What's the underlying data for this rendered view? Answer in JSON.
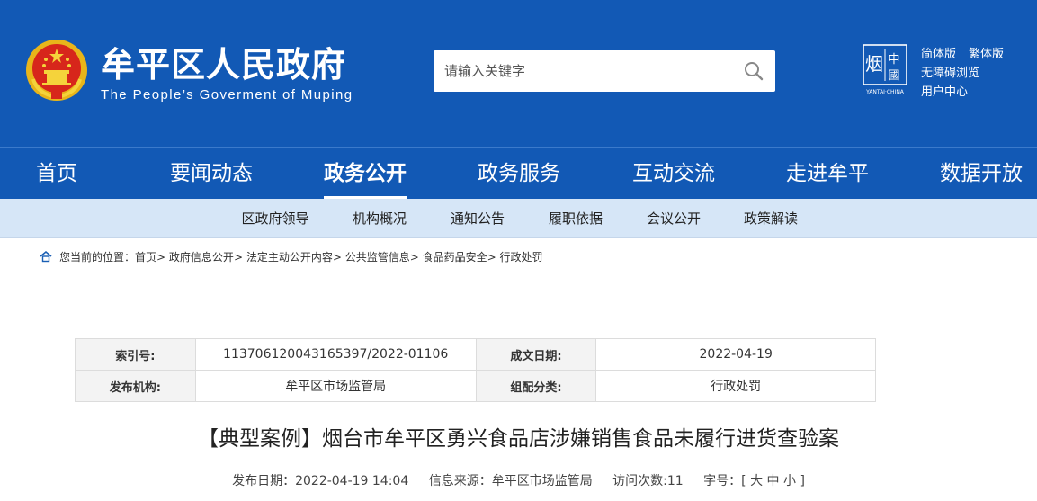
{
  "header": {
    "title": "牟平区人民政府",
    "subtitle": "The People’s Goverment of Muping",
    "search": {
      "placeholder": "请输入关键字"
    },
    "yantai_logo_text": "YANTAI·CHINA",
    "links": {
      "simplified": "简体版",
      "traditional": "繁体版",
      "accessible": "无障碍浏览",
      "user_center": "用户中心"
    }
  },
  "nav": {
    "items": [
      "首页",
      "要闻动态",
      "政务公开",
      "政务服务",
      "互动交流",
      "走进牟平",
      "数据开放"
    ],
    "active": "政务公开"
  },
  "subnav": {
    "items": [
      "区政府领导",
      "机构概况",
      "通知公告",
      "履职依据",
      "会议公开",
      "政策解读"
    ]
  },
  "breadcrumb": {
    "prefix": "您当前的位置：",
    "crumbs": [
      "首页",
      "政府信息公开",
      "法定主动公开内容",
      "公共监管信息",
      "食品药品安全",
      "行政处罚"
    ],
    "sep": ">"
  },
  "meta": {
    "index_label": "索引号:",
    "index_value": "11370612004316539​7/2022-01106",
    "date_label": "成文日期:",
    "date_value": "2022-04-19",
    "publisher_label": "发布机构:",
    "publisher_value": "牟平区市场监管局",
    "category_label": "组配分类:",
    "category_value": "行政处罚"
  },
  "article": {
    "title": "【典型案例】烟台市牟平区勇兴食品店涉嫌销售食品未履行进货查验案",
    "publish_date": "发布日期：2022-04-19 14:04",
    "source": "信息来源：牟平区市场监管局",
    "visits": "访问次数:11",
    "font_size_label": "字号：[",
    "font_large": "大",
    "font_medium": "中",
    "font_small": "小",
    "font_size_end": "]"
  },
  "colors": {
    "header_blue": "#1259b5",
    "subnav_bg": "#d6e6f7"
  }
}
